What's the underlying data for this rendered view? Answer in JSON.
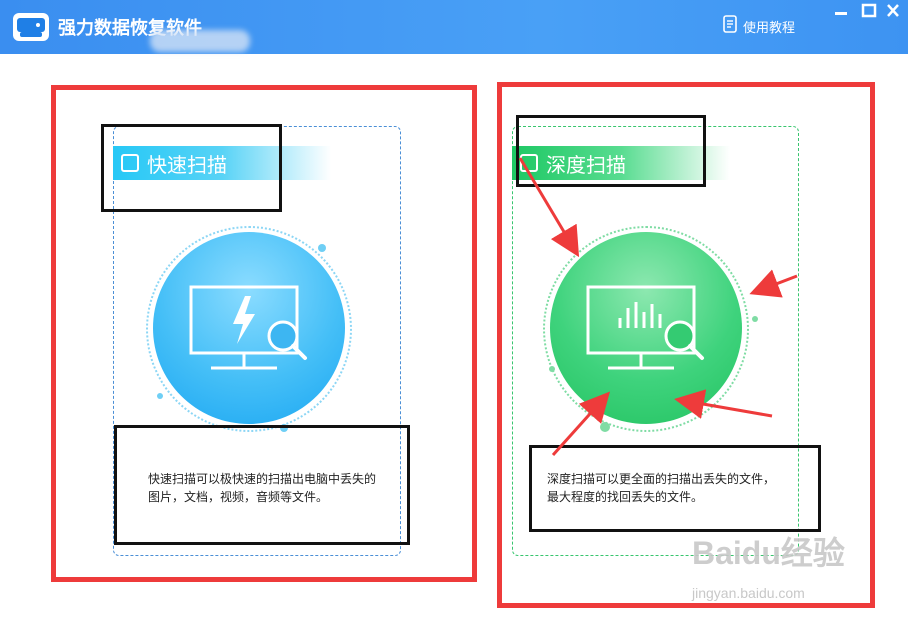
{
  "app": {
    "title": "强力数据恢复软件",
    "help_label": "使用教程"
  },
  "window_controls": {
    "minimize": "—",
    "maximize": "□",
    "close": "✕"
  },
  "quick_scan": {
    "title": "快速扫描",
    "description": "快速扫描可以极快速的扫描出电脑中丢失的图片，文档，视频，音频等文件。",
    "color": "#26c8f6"
  },
  "deep_scan": {
    "title": "深度扫描",
    "description": "深度扫描可以更全面的扫描出丢失的文件，最大程度的找回丢失的文件。",
    "color": "#1ec864"
  },
  "watermark": {
    "brand": "Baidu经验",
    "url": "jingyan.baidu.com"
  },
  "annotation_color": "#ee3b3b"
}
